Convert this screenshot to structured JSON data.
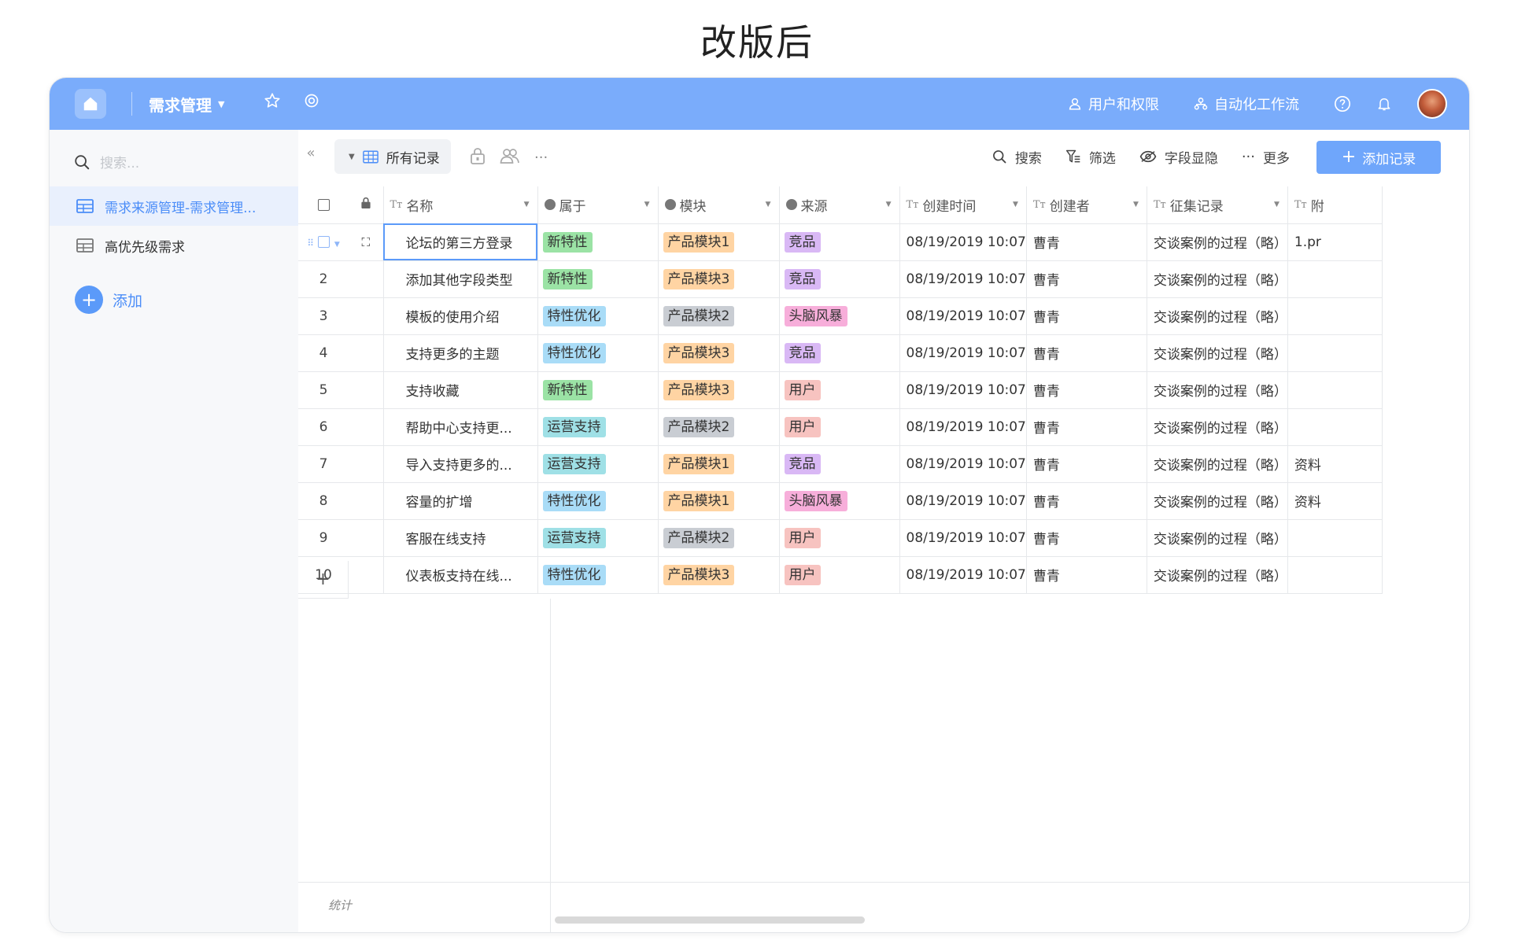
{
  "page_heading": "改版后",
  "topbar": {
    "app_title": "需求管理",
    "users_label": "用户和权限",
    "workflow_label": "自动化工作流",
    "colors": {
      "bar": "#7aacfb"
    }
  },
  "sidebar": {
    "search_placeholder": "搜索...",
    "items": [
      {
        "label": "需求来源管理-需求管理...",
        "active": true
      },
      {
        "label": "高优先级需求",
        "active": false
      }
    ],
    "add_label": "添加"
  },
  "toolbar": {
    "view_label": "所有记录",
    "more_dots": "···",
    "search_label": "搜索",
    "filter_label": "筛选",
    "fields_label": "字段显隐",
    "more_label": "更多",
    "add_record_label": "添加记录"
  },
  "columns": {
    "name": "名称",
    "belongs": "属于",
    "module": "模块",
    "source": "来源",
    "created_time": "创建时间",
    "creator": "创建者",
    "collection": "征集记录",
    "attachment": "附"
  },
  "tag_colors": {
    "新特性": "#9be3a5",
    "特性优化": "#a9dcf7",
    "运营支持": "#9fe0e6",
    "产品模块1": "#ffd4a3",
    "产品模块2": "#c9cdd3",
    "产品模块3": "#ffd4a3",
    "竞品": "#d9b8f5",
    "头脑风暴": "#f7aeda",
    "用户": "#f7c3c0"
  },
  "rows": [
    {
      "num": "1",
      "name": "论坛的第三方登录",
      "belongs": "新特性",
      "module": "产品模块1",
      "source": "竞品",
      "time": "08/19/2019 10:07",
      "creator": "曹青",
      "collection": "交谈案例的过程（略）",
      "attachment": "1.pr"
    },
    {
      "num": "2",
      "name": "添加其他字段类型",
      "belongs": "新特性",
      "module": "产品模块3",
      "source": "竞品",
      "time": "08/19/2019 10:07",
      "creator": "曹青",
      "collection": "交谈案例的过程（略）",
      "attachment": ""
    },
    {
      "num": "3",
      "name": "模板的使用介绍",
      "belongs": "特性优化",
      "module": "产品模块2",
      "source": "头脑风暴",
      "time": "08/19/2019 10:07",
      "creator": "曹青",
      "collection": "交谈案例的过程（略）",
      "attachment": ""
    },
    {
      "num": "4",
      "name": "支持更多的主题",
      "belongs": "特性优化",
      "module": "产品模块3",
      "source": "竞品",
      "time": "08/19/2019 10:07",
      "creator": "曹青",
      "collection": "交谈案例的过程（略）",
      "attachment": ""
    },
    {
      "num": "5",
      "name": "支持收藏",
      "belongs": "新特性",
      "module": "产品模块3",
      "source": "用户",
      "time": "08/19/2019 10:07",
      "creator": "曹青",
      "collection": "交谈案例的过程（略）",
      "attachment": ""
    },
    {
      "num": "6",
      "name": "帮助中心支持更...",
      "belongs": "运营支持",
      "module": "产品模块2",
      "source": "用户",
      "time": "08/19/2019 10:07",
      "creator": "曹青",
      "collection": "交谈案例的过程（略）",
      "attachment": ""
    },
    {
      "num": "7",
      "name": "导入支持更多的...",
      "belongs": "运营支持",
      "module": "产品模块1",
      "source": "竞品",
      "time": "08/19/2019 10:07",
      "creator": "曹青",
      "collection": "交谈案例的过程（略）",
      "attachment": "资料"
    },
    {
      "num": "8",
      "name": "容量的扩增",
      "belongs": "特性优化",
      "module": "产品模块1",
      "source": "头脑风暴",
      "time": "08/19/2019 10:07",
      "creator": "曹青",
      "collection": "交谈案例的过程（略）",
      "attachment": "资料"
    },
    {
      "num": "9",
      "name": "客服在线支持",
      "belongs": "运营支持",
      "module": "产品模块2",
      "source": "用户",
      "time": "08/19/2019 10:07",
      "creator": "曹青",
      "collection": "交谈案例的过程（略）",
      "attachment": ""
    },
    {
      "num": "10",
      "name": "仪表板支持在线...",
      "belongs": "特性优化",
      "module": "产品模块3",
      "source": "用户",
      "time": "08/19/2019 10:07",
      "creator": "曹青",
      "collection": "交谈案例的过程（略）",
      "attachment": ""
    }
  ],
  "add_row_label": "+",
  "footer": {
    "stat_label": "统计"
  }
}
